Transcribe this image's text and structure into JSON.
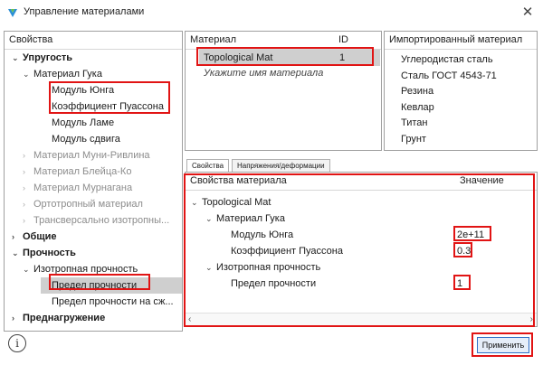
{
  "window": {
    "title": "Управление материалами",
    "close_symbol": "✕"
  },
  "left_panel": {
    "header": "Свойства",
    "items": [
      {
        "label": "Упругость",
        "level": 0,
        "expanded": true,
        "bold": true
      },
      {
        "label": "Материал Гука",
        "level": 1,
        "expanded": true
      },
      {
        "label": "Модуль Юнга",
        "level": 2
      },
      {
        "label": "Коэффициент Пуассона",
        "level": 2
      },
      {
        "label": "Модуль Ламе",
        "level": 2
      },
      {
        "label": "Модуль сдвига",
        "level": 2
      },
      {
        "label": "Материал Муни-Ривлина",
        "level": 1,
        "expanded": false,
        "disabled": true
      },
      {
        "label": "Материал Блейца-Ко",
        "level": 1,
        "expanded": false,
        "disabled": true
      },
      {
        "label": "Материал Мурнагана",
        "level": 1,
        "expanded": false,
        "disabled": true
      },
      {
        "label": "Ортотропный материал",
        "level": 1,
        "expanded": false,
        "disabled": true
      },
      {
        "label": "Трансверсально изотропны...",
        "level": 1,
        "expanded": false,
        "disabled": true
      },
      {
        "label": "Общие",
        "level": 0,
        "expanded": false,
        "bold": true
      },
      {
        "label": "Прочность",
        "level": 0,
        "expanded": true,
        "bold": true
      },
      {
        "label": "Изотропная прочность",
        "level": 1,
        "expanded": true
      },
      {
        "label": "Предел прочности",
        "level": 2,
        "selected": true
      },
      {
        "label": "Предел прочности на сж...",
        "level": 2
      },
      {
        "label": "Преднагружение",
        "level": 0,
        "expanded": false,
        "bold": true
      }
    ]
  },
  "material_table": {
    "col_material": "Материал",
    "col_id": "ID",
    "rows": [
      {
        "name": "Topological Mat",
        "id": "1"
      }
    ],
    "placeholder": "Укажите имя материала"
  },
  "imported_panel": {
    "header": "Импортированный материал",
    "items": [
      "Углеродистая сталь",
      "Сталь ГОСТ 4543-71",
      "Резина",
      "Кевлар",
      "Титан",
      "Грунт"
    ]
  },
  "tabs": [
    {
      "label": "Свойства",
      "active": true
    },
    {
      "label": "Напряжения/деформации",
      "active": false
    }
  ],
  "properties_tree": {
    "col_props": "Свойства материала",
    "col_value": "Значение",
    "rows": [
      {
        "label": "Topological Mat",
        "level": 0,
        "expanded": true,
        "value": ""
      },
      {
        "label": "Материал Гука",
        "level": 1,
        "expanded": true,
        "value": ""
      },
      {
        "label": "Модуль Юнга",
        "level": 2,
        "value": "2e+11"
      },
      {
        "label": "Коэффициент Пуассона",
        "level": 2,
        "value": "0.3"
      },
      {
        "label": "Изотропная прочность",
        "level": 1,
        "expanded": true,
        "value": ""
      },
      {
        "label": "Предел прочности",
        "level": 2,
        "value": "1"
      }
    ]
  },
  "buttons": {
    "info_symbol": "i",
    "apply": "Применить"
  },
  "colors": {
    "highlight": "#e11414",
    "selection": "#cfcfcf",
    "apply_border": "#2f6fc7"
  }
}
